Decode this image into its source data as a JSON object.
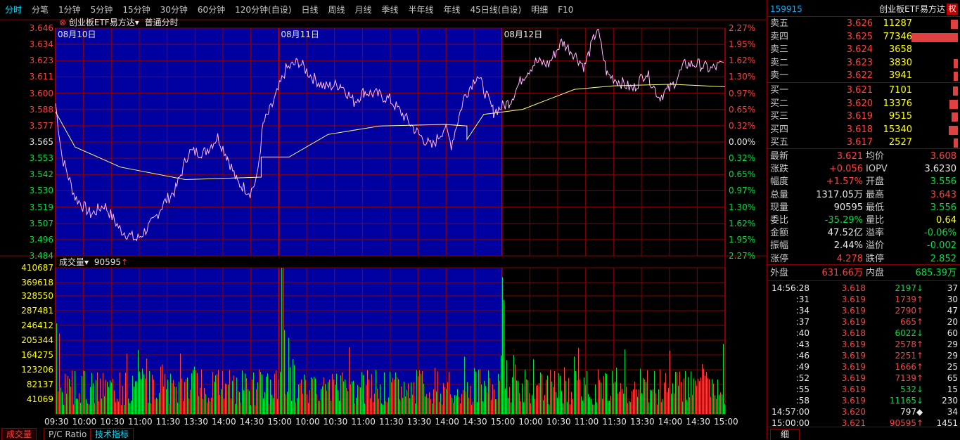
{
  "tabs": [
    "分时",
    "分笔",
    "1分钟",
    "5分钟",
    "15分钟",
    "30分钟",
    "60分钟",
    "120分钟(自设)",
    "日线",
    "周线",
    "月线",
    "季线",
    "半年线",
    "年线",
    "45日线(自设)",
    "明细",
    "F10"
  ],
  "active_tab": 0,
  "chart_header": {
    "stock_name": "创业板ETF易方达",
    "mode": "普通分时"
  },
  "price_axis_left": [
    "3.646",
    "3.634",
    "3.623",
    "3.611",
    "3.600",
    "3.588",
    "3.577",
    "3.565",
    "3.553",
    "3.542",
    "3.530",
    "3.519",
    "3.507",
    "3.496",
    "3.484"
  ],
  "price_axis_right": [
    "2.27%",
    "1.95%",
    "1.62%",
    "1.30%",
    "0.97%",
    "0.65%",
    "0.32%",
    "0.00%",
    "0.32%",
    "0.65%",
    "0.97%",
    "1.30%",
    "1.62%",
    "1.95%",
    "2.27%"
  ],
  "day_labels": [
    "08月10日",
    "08月11日",
    "08月12日"
  ],
  "volume_header": {
    "label": "成交量",
    "value": "90595"
  },
  "volume_axis": [
    "410687",
    "369618",
    "328550",
    "287481",
    "246412",
    "205344",
    "164275",
    "123206",
    "82137",
    "41069"
  ],
  "time_axis": [
    "09:30",
    "10:00",
    "10:30",
    "11:00",
    "11:30",
    "13:30",
    "14:00",
    "14:30",
    "15:00",
    "10:00",
    "10:30",
    "11:00",
    "11:30",
    "13:30",
    "14:00",
    "14:30",
    "15:00",
    "10:00",
    "10:30",
    "11:00",
    "11:30",
    "13:30",
    "14:00",
    "14:30",
    "15:00"
  ],
  "bottom_tabs": [
    "成交量",
    "P/C Ratio",
    "技术指标"
  ],
  "panel": {
    "code": "159915",
    "name": "创业板ETF易方达",
    "badge": "权",
    "asks": [
      {
        "label": "卖五",
        "price": "3.626",
        "vol": "11287",
        "bar": 0.15
      },
      {
        "label": "卖四",
        "price": "3.625",
        "vol": "77346",
        "bar": 1.0
      },
      {
        "label": "卖三",
        "price": "3.624",
        "vol": "3658",
        "bar": 0.0
      },
      {
        "label": "卖二",
        "price": "3.623",
        "vol": "3830",
        "bar": 0.05
      },
      {
        "label": "卖一",
        "price": "3.622",
        "vol": "3941",
        "bar": 0.05
      }
    ],
    "bids": [
      {
        "label": "买一",
        "price": "3.621",
        "vol": "7101",
        "bar": 0.1
      },
      {
        "label": "买二",
        "price": "3.620",
        "vol": "13376",
        "bar": 0.18
      },
      {
        "label": "买三",
        "price": "3.619",
        "vol": "9515",
        "bar": 0.13
      },
      {
        "label": "买四",
        "price": "3.618",
        "vol": "15340",
        "bar": 0.2
      },
      {
        "label": "买五",
        "price": "3.617",
        "vol": "2527",
        "bar": 0.04
      }
    ],
    "stats": [
      {
        "l1": "最新",
        "v1": "3.621",
        "c1": "red",
        "l2": "均价",
        "v2": "3.608",
        "c2": "red"
      },
      {
        "l1": "涨跌",
        "v1": "+0.056",
        "c1": "red",
        "l2": "IOPV",
        "v2": "3.6230",
        "c2": "wht"
      },
      {
        "l1": "幅度",
        "v1": "+1.57%",
        "c1": "red",
        "l2": "开盘",
        "v2": "3.556",
        "c2": "grn"
      },
      {
        "l1": "总量",
        "v1": "1317.05万",
        "c1": "wht",
        "l2": "最高",
        "v2": "3.643",
        "c2": "red"
      },
      {
        "l1": "现量",
        "v1": "90595",
        "c1": "wht",
        "l2": "最低",
        "v2": "3.556",
        "c2": "grn"
      },
      {
        "l1": "委比",
        "v1": "-35.29%",
        "c1": "grn",
        "l2": "量比",
        "v2": "0.64",
        "c2": "yel"
      },
      {
        "l1": "金额",
        "v1": "47.52亿",
        "c1": "wht",
        "l2": "溢率",
        "v2": "-0.06%",
        "c2": "grn"
      },
      {
        "l1": "振幅",
        "v1": "2.44%",
        "c1": "wht",
        "l2": "溢价",
        "v2": "-0.002",
        "c2": "grn"
      },
      {
        "l1": "涨停",
        "v1": "4.278",
        "c1": "red",
        "l2": "跌停",
        "v2": "2.852",
        "c2": "grn"
      }
    ],
    "outer": {
      "label": "外盘",
      "value": "631.66万"
    },
    "inner": {
      "label": "内盘",
      "value": "685.39万"
    },
    "ticks": [
      {
        "t": "14:56:28",
        "p": "3.618",
        "pc": "red",
        "v": "2197",
        "arrow": "↓",
        "ac": "grn",
        "n": "37"
      },
      {
        "t": ":31",
        "p": "3.619",
        "pc": "red",
        "v": "1739",
        "arrow": "↑",
        "ac": "red",
        "n": "30"
      },
      {
        "t": ":34",
        "p": "3.619",
        "pc": "red",
        "v": "2790",
        "arrow": "↑",
        "ac": "red",
        "n": "47"
      },
      {
        "t": ":37",
        "p": "3.619",
        "pc": "red",
        "v": "665",
        "arrow": "↑",
        "ac": "red",
        "n": "20"
      },
      {
        "t": ":40",
        "p": "3.618",
        "pc": "red",
        "v": "6022",
        "arrow": "↓",
        "ac": "grn",
        "n": "60"
      },
      {
        "t": ":43",
        "p": "3.619",
        "pc": "red",
        "v": "2578",
        "arrow": "↑",
        "ac": "red",
        "n": "29"
      },
      {
        "t": ":46",
        "p": "3.619",
        "pc": "red",
        "v": "2251",
        "arrow": "↑",
        "ac": "red",
        "n": "29"
      },
      {
        "t": ":49",
        "p": "3.619",
        "pc": "red",
        "v": "1666",
        "arrow": "↑",
        "ac": "red",
        "n": "25"
      },
      {
        "t": ":52",
        "p": "3.619",
        "pc": "red",
        "v": "7139",
        "arrow": "↑",
        "ac": "red",
        "n": "65"
      },
      {
        "t": ":55",
        "p": "3.619",
        "pc": "red",
        "v": "532",
        "arrow": "↓",
        "ac": "grn",
        "n": "15"
      },
      {
        "t": ":58",
        "p": "3.619",
        "pc": "red",
        "v": "11165",
        "arrow": "↓",
        "ac": "grn",
        "n": "230"
      },
      {
        "t": "14:57:00",
        "p": "3.620",
        "pc": "red",
        "v": "797",
        "arrow": "◆",
        "ac": "wht",
        "n": "34"
      },
      {
        "t": "15:00:00",
        "p": "3.621",
        "pc": "red",
        "v": "90595",
        "arrow": "↑",
        "ac": "red",
        "n": "1451"
      }
    ],
    "detail_tab": "细"
  },
  "colors": {
    "grid": "#8a0000",
    "bg_blue": "#0000a0",
    "price_line": "#ff80ff",
    "avg_line": "#ffff80",
    "up": "#ff4040",
    "down": "#00e040"
  }
}
